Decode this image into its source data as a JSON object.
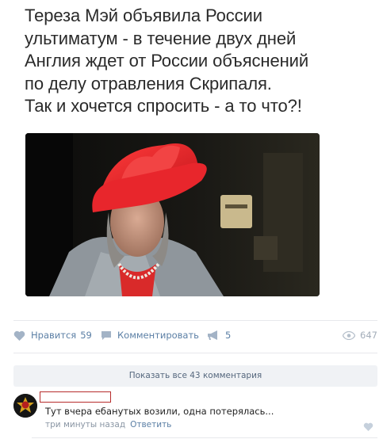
{
  "post": {
    "text_lines": [
      "Тереза Мэй объявила России",
      "ультиматум - в течение двух дней",
      "Англия ждет от России объяснений",
      "по делу отравления Скрипаля.",
      "Так и хочется спросить - а то что?!"
    ]
  },
  "actions": {
    "like_label": "Нравится",
    "like_count": "59",
    "comment_label": "Комментировать",
    "share_count": "5",
    "views_count": "647"
  },
  "comments": {
    "show_all_label": "Показать все 43 комментария",
    "items": [
      {
        "text": "Тут вчера ебанутых возили, одна потерялась...",
        "time": "три минуты назад",
        "reply_label": "Ответить"
      }
    ]
  },
  "colors": {
    "link": "#5b7fa5",
    "muted": "#8a96a4",
    "hat": "#e8262c",
    "redaction": "#b72c2c"
  },
  "icons": {
    "like": "heart-icon",
    "comment": "speech-bubble-icon",
    "share": "megaphone-icon",
    "views": "eye-icon"
  }
}
